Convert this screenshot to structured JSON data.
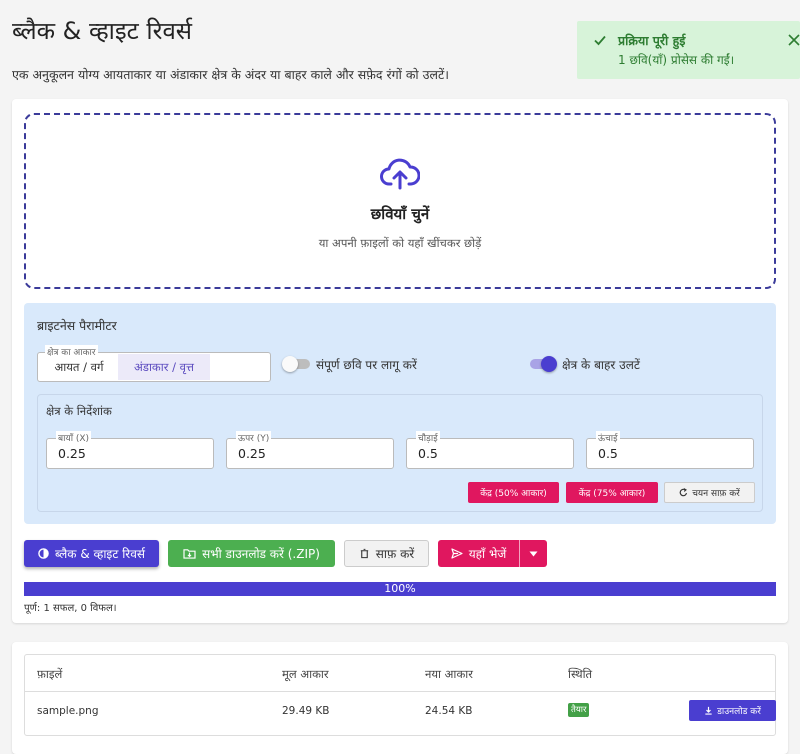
{
  "header": {
    "title": "ब्लैक & व्हाइट रिवर्स",
    "subtitle": "एक अनुकूलन योग्य आयताकार या अंडाकार क्षेत्र के अंदर या बाहर काले और सफ़ेद रंगों को उलटें।"
  },
  "toast": {
    "title": "प्रक्रिया पूरी हुई",
    "message": "1 छवि(याँ) प्रोसेस की गईं।",
    "icon": "check-icon",
    "close_icon": "close-icon"
  },
  "dropzone": {
    "icon": "cloud-upload-icon",
    "title": "छवियाँ चुनें",
    "subtitle": "या अपनी फ़ाइलों को यहाँ खींचकर छोड़ें"
  },
  "params": {
    "title": "ब्राइटनेस पैरामीटर",
    "shape_legend": "क्षेत्र का आकार",
    "shape_options": [
      "आयत / वर्ग",
      "अंडाकार / वृत्त"
    ],
    "shape_selected": "अंडाकार / वृत्त",
    "apply_full_label": "संपूर्ण छवि पर लागू करें",
    "apply_full_on": false,
    "invert_outside_label": "क्षेत्र के बाहर उलटें",
    "invert_outside_on": true,
    "coords_title": "क्षेत्र के निर्देशांक",
    "fields": [
      {
        "label": "बायाँ (X)",
        "value": "0.25"
      },
      {
        "label": "ऊपर (Y)",
        "value": "0.25"
      },
      {
        "label": "चौड़ाई",
        "value": "0.5"
      },
      {
        "label": "ऊंचाई",
        "value": "0.5"
      }
    ],
    "preset_50": "केंद्र (50% आकार)",
    "preset_75": "केंद्र (75% आकार)",
    "reset_selection": "चयन साफ़ करें"
  },
  "actions": {
    "process": "ब्लैक & व्हाइट रिवर्स",
    "download_zip": "सभी डाउनलोड करें (.ZIP)",
    "clear": "साफ़ करें",
    "send_here": "यहाँ भेजें"
  },
  "progress": {
    "percent": 100,
    "label": "100%",
    "status": "पूर्ण: 1 सफल, 0 विफल।"
  },
  "results": {
    "columns": [
      "फ़ाइलें",
      "मूल आकार",
      "नया आकार",
      "स्थिति"
    ],
    "rows": [
      {
        "file": "sample.png",
        "original_size": "29.49 KB",
        "new_size": "24.54 KB",
        "status": "तैयार",
        "download": "डाउनलोड करें"
      }
    ]
  },
  "colors": {
    "accent": "#4a3ed0",
    "pink": "#e0175f",
    "green": "#4caf50",
    "panel": "#d9e9fb"
  }
}
